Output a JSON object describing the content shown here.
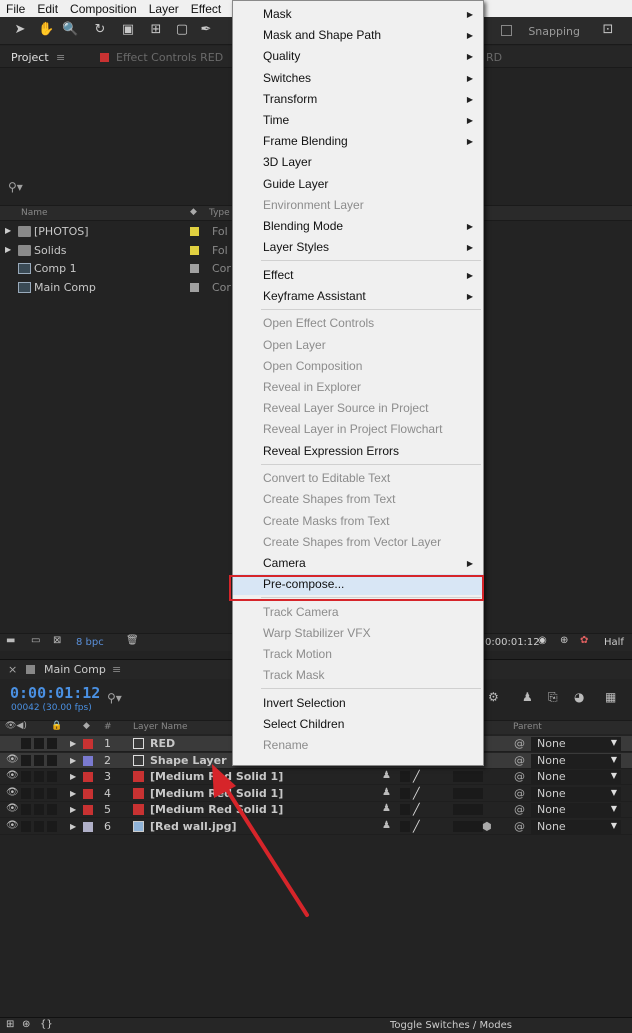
{
  "menubar": [
    "File",
    "Edit",
    "Composition",
    "Layer",
    "Effect"
  ],
  "toolbar": {
    "snapping": "Snapping"
  },
  "project_panel": {
    "tab_project": "Project",
    "tab_effect_controls": "Effect Controls RED",
    "tab_right_fragment": "RD",
    "search_icon": "search-icon",
    "col_name": "Name",
    "col_type": "Type",
    "items": [
      {
        "name": "[PHOTOS]",
        "type": "Fol",
        "kind": "folder",
        "label_color": "#e0d040"
      },
      {
        "name": "Solids",
        "type": "Fol",
        "kind": "folder",
        "label_color": "#e0d040"
      },
      {
        "name": "Comp 1",
        "type": "Cor",
        "kind": "comp",
        "label_color": "#a0a0a0"
      },
      {
        "name": "Main Comp",
        "type": "Cor",
        "kind": "comp",
        "label_color": "#a0a0a0"
      }
    ],
    "bpc": "8 bpc"
  },
  "viewer_bar": {
    "time": "0:00:01:12",
    "resolution": "Half"
  },
  "timeline": {
    "tab": "Main Comp",
    "timecode": "0:00:01:12",
    "fps": "00042 (30.00 fps)",
    "col_layer_name": "Layer Name",
    "col_parent": "Parent",
    "col_hash": "#",
    "layers": [
      {
        "num": "1",
        "name": "RED",
        "color": "#c83232",
        "parent": "None",
        "selected": true
      },
      {
        "num": "2",
        "name": "Shape Layer",
        "color": "#7a7ad0",
        "parent": "None",
        "selected": true
      },
      {
        "num": "3",
        "name": "[Medium Red Solid 1]",
        "color": "#c83232",
        "parent": "None",
        "selected": false
      },
      {
        "num": "4",
        "name": "[Medium Red Solid 1]",
        "color": "#c83232",
        "parent": "None",
        "selected": false
      },
      {
        "num": "5",
        "name": "[Medium Red Solid 1]",
        "color": "#c83232",
        "parent": "None",
        "selected": false
      },
      {
        "num": "6",
        "name": "[Red wall.jpg]",
        "color": "#b0b0c8",
        "parent": "None",
        "selected": false
      }
    ],
    "toggle": "Toggle Switches / Modes"
  },
  "context_menu": {
    "items": [
      {
        "label": "Mask",
        "submenu": true,
        "disabled": false
      },
      {
        "label": "Mask and Shape Path",
        "submenu": true,
        "disabled": false
      },
      {
        "label": "Quality",
        "submenu": true,
        "disabled": false
      },
      {
        "label": "Switches",
        "submenu": true,
        "disabled": false
      },
      {
        "label": "Transform",
        "submenu": true,
        "disabled": false
      },
      {
        "label": "Time",
        "submenu": true,
        "disabled": false
      },
      {
        "label": "Frame Blending",
        "submenu": true,
        "disabled": false
      },
      {
        "label": "3D Layer",
        "submenu": false,
        "disabled": false
      },
      {
        "label": "Guide Layer",
        "submenu": false,
        "disabled": false
      },
      {
        "label": "Environment Layer",
        "submenu": false,
        "disabled": true
      },
      {
        "label": "Blending Mode",
        "submenu": true,
        "disabled": false
      },
      {
        "label": "Layer Styles",
        "submenu": true,
        "disabled": false
      },
      {
        "label": "Effect",
        "submenu": true,
        "disabled": false
      },
      {
        "label": "Keyframe Assistant",
        "submenu": true,
        "disabled": false
      },
      {
        "label": "Open Effect Controls",
        "submenu": false,
        "disabled": true
      },
      {
        "label": "Open Layer",
        "submenu": false,
        "disabled": true
      },
      {
        "label": "Open Composition",
        "submenu": false,
        "disabled": true
      },
      {
        "label": "Reveal in Explorer",
        "submenu": false,
        "disabled": true
      },
      {
        "label": "Reveal Layer Source in Project",
        "submenu": false,
        "disabled": true
      },
      {
        "label": "Reveal Layer in Project Flowchart",
        "submenu": false,
        "disabled": true
      },
      {
        "label": "Reveal Expression Errors",
        "submenu": false,
        "disabled": false
      },
      {
        "label": "Convert to Editable Text",
        "submenu": false,
        "disabled": true
      },
      {
        "label": "Create Shapes from Text",
        "submenu": false,
        "disabled": true
      },
      {
        "label": "Create Masks from Text",
        "submenu": false,
        "disabled": true
      },
      {
        "label": "Create Shapes from Vector Layer",
        "submenu": false,
        "disabled": true
      },
      {
        "label": "Camera",
        "submenu": true,
        "disabled": false
      },
      {
        "label": "Pre-compose...",
        "submenu": false,
        "disabled": false,
        "highlighted": true
      },
      {
        "label": "Track Camera",
        "submenu": false,
        "disabled": true
      },
      {
        "label": "Warp Stabilizer VFX",
        "submenu": false,
        "disabled": true
      },
      {
        "label": "Track Motion",
        "submenu": false,
        "disabled": true
      },
      {
        "label": "Track Mask",
        "submenu": false,
        "disabled": true
      },
      {
        "label": "Invert Selection",
        "submenu": false,
        "disabled": false
      },
      {
        "label": "Select Children",
        "submenu": false,
        "disabled": false
      },
      {
        "label": "Rename",
        "submenu": false,
        "disabled": true
      }
    ]
  },
  "colors": {
    "highlight_box": "#d6252a",
    "arrow": "#d6252a",
    "timecode": "#4a90e2"
  }
}
